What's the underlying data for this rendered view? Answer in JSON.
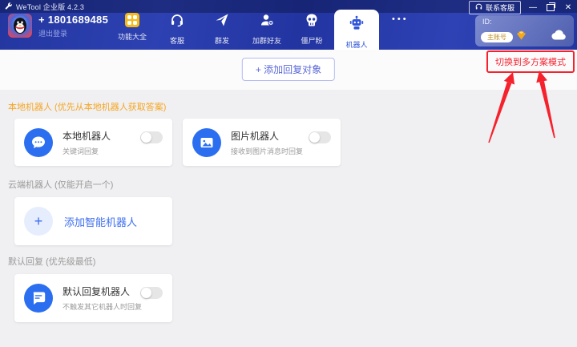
{
  "titlebar": {
    "app_title": "WeTool 企业版 4.2.3",
    "contact_support": "联系客服",
    "minimize": "—",
    "close": "✕"
  },
  "header": {
    "phone": "+ 1801689485",
    "logout": "退出登录",
    "tabs": [
      {
        "label": "功能大全",
        "icon": "grid-icon"
      },
      {
        "label": "客服",
        "icon": "headset-icon"
      },
      {
        "label": "群发",
        "icon": "send-icon"
      },
      {
        "label": "加群好友",
        "icon": "person-add-icon"
      },
      {
        "label": "僵尸粉",
        "icon": "skull-icon"
      },
      {
        "label": "机器人",
        "icon": "robot-icon",
        "active": true
      }
    ],
    "more_label": "•••",
    "id_card": {
      "id_label": "ID:",
      "badge": "主账号",
      "gem_icon": "gem",
      "cloud_icon": "cloud"
    }
  },
  "main": {
    "add_reply_label": "+ 添加回复对象",
    "switch_mode_label": "切换到多方案模式",
    "sections": {
      "local": {
        "title": "本地机器人 (优先从本地机器人获取答案)"
      },
      "cloud": {
        "title": "云端机器人 (仅能开启一个)"
      },
      "default": {
        "title": "默认回复 (优先级最低)"
      }
    },
    "cards": {
      "local_robot": {
        "title": "本地机器人",
        "subtitle": "关键词回复",
        "enabled": false
      },
      "image_robot": {
        "title": "图片机器人",
        "subtitle": "接收到图片消息时回复",
        "enabled": false
      },
      "add_smart_robot": {
        "label": "添加智能机器人",
        "plus": "+"
      },
      "default_robot": {
        "title": "默认回复机器人",
        "subtitle": "不触发其它机器人时回复",
        "enabled": false
      }
    }
  },
  "colors": {
    "header_blue": "#2336a0",
    "titlebar_navy": "#1a2566",
    "accent_yellow": "#f6b915",
    "card_icon_blue": "#2b6ff0",
    "section_orange": "#f5a623",
    "annotation_red": "#f5222d",
    "link_indigo": "#5a68d8",
    "active_tab_blue": "#2f54d8"
  }
}
